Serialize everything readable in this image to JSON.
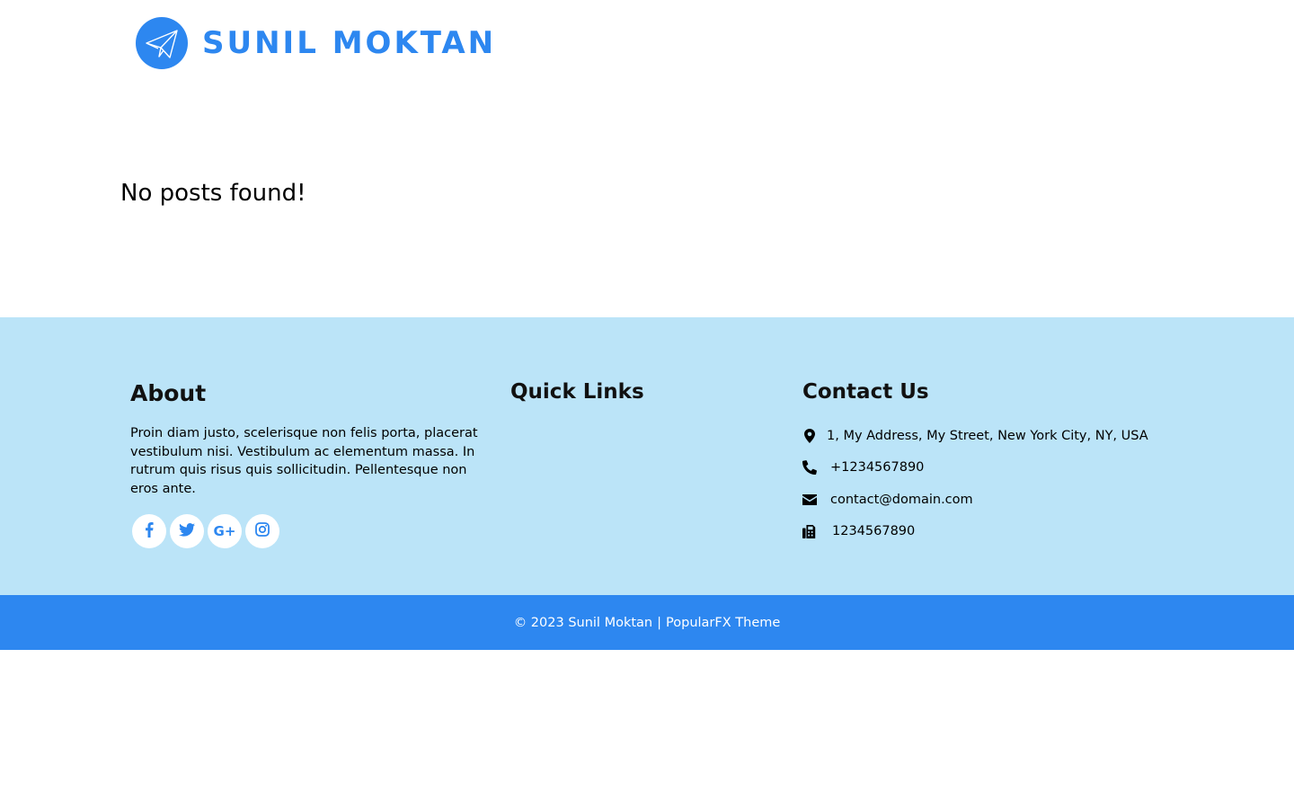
{
  "header": {
    "site_title": "SUNIL MOKTAN",
    "logo_icon": "paper-plane-icon"
  },
  "main": {
    "message": "No posts found!"
  },
  "footer": {
    "about": {
      "title": "About",
      "text": "Proin diam justo, scelerisque non felis porta, placerat vestibulum nisi. Vestibulum ac elementum massa. In rutrum quis risus quis sollicitudin. Pellentesque non eros ante.",
      "social": [
        {
          "icon": "facebook-icon",
          "glyph": "f"
        },
        {
          "icon": "twitter-icon",
          "glyph": ""
        },
        {
          "icon": "google-plus-icon",
          "glyph": "G+"
        },
        {
          "icon": "instagram-icon",
          "glyph": ""
        }
      ]
    },
    "quick_links": {
      "title": "Quick Links"
    },
    "contact": {
      "title": "Contact Us",
      "address": "1, My Address, My Street, New York City, NY, USA",
      "phone": "+1234567890",
      "email": "contact@domain.com",
      "fax": "1234567890"
    }
  },
  "bottom_bar": {
    "copyright": "© 2023 Sunil Moktan",
    "separator": "|",
    "theme_link": "PopularFX Theme"
  },
  "colors": {
    "brand_blue": "#2d87f0",
    "footer_light_blue": "#bbe4f8"
  }
}
